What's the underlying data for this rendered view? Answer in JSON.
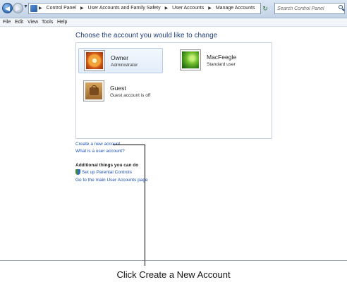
{
  "address": {
    "crumbs": [
      "Control Panel",
      "User Accounts and Family Safety",
      "User Accounts",
      "Manage Accounts"
    ],
    "search_placeholder": "Search Control Panel"
  },
  "menu": [
    "File",
    "Edit",
    "View",
    "Tools",
    "Help"
  ],
  "main": {
    "title": "Choose the account you would like to change",
    "accounts": [
      {
        "name": "Owner",
        "type": "Administrator",
        "picture": "flower"
      },
      {
        "name": "MacFeegle",
        "type": "Standard user",
        "picture": "leaf"
      },
      {
        "name": "Guest",
        "type": "Guest account is off",
        "picture": "briefcase"
      }
    ],
    "links": {
      "create": "Create a new account",
      "what_is": "What is a user account?"
    },
    "additional": {
      "heading": "Additional things you can do",
      "parental": "Set up Parental Controls",
      "main_page": "Go to the main User Accounts page"
    }
  },
  "caption": "Click Create a New Account"
}
